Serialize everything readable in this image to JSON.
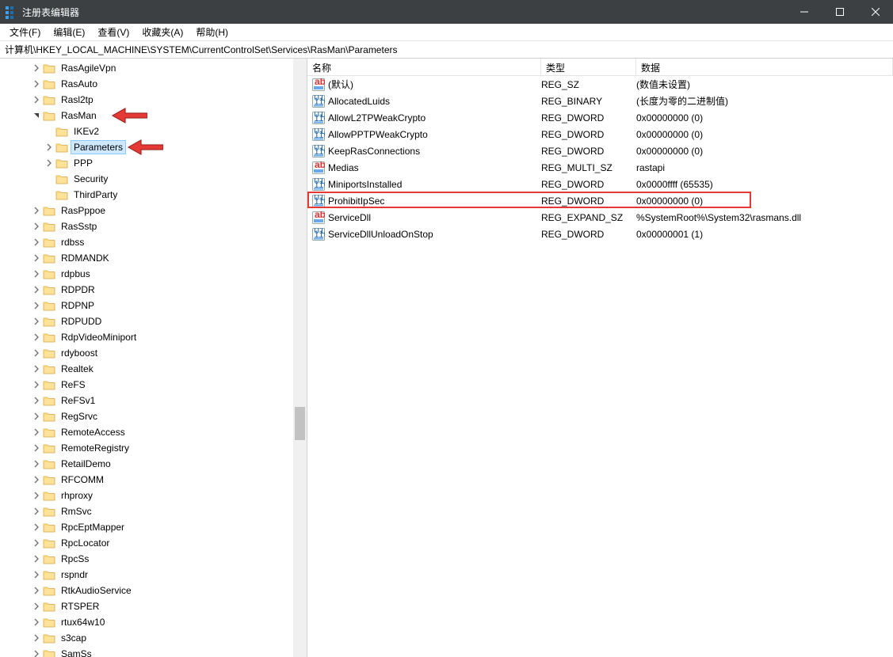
{
  "window": {
    "title": "注册表编辑器"
  },
  "menu": {
    "file": "文件(F)",
    "edit": "编辑(E)",
    "view": "查看(V)",
    "fav": "收藏夹(A)",
    "help": "帮助(H)"
  },
  "pathbar": "计算机\\HKEY_LOCAL_MACHINE\\SYSTEM\\CurrentControlSet\\Services\\RasMan\\Parameters",
  "tree": [
    {
      "indent": 2,
      "exp": ">",
      "label": "RasAgileVpn"
    },
    {
      "indent": 2,
      "exp": ">",
      "label": "RasAuto"
    },
    {
      "indent": 2,
      "exp": ">",
      "label": "Rasl2tp"
    },
    {
      "indent": 2,
      "exp": "v",
      "label": "RasMan",
      "arrow": 1
    },
    {
      "indent": 3,
      "exp": "",
      "label": "IKEv2"
    },
    {
      "indent": 3,
      "exp": ">",
      "label": "Parameters",
      "selected": true,
      "arrow": 2
    },
    {
      "indent": 3,
      "exp": ">",
      "label": "PPP"
    },
    {
      "indent": 3,
      "exp": "",
      "label": "Security"
    },
    {
      "indent": 3,
      "exp": "",
      "label": "ThirdParty"
    },
    {
      "indent": 2,
      "exp": ">",
      "label": "RasPppoe"
    },
    {
      "indent": 2,
      "exp": ">",
      "label": "RasSstp"
    },
    {
      "indent": 2,
      "exp": ">",
      "label": "rdbss"
    },
    {
      "indent": 2,
      "exp": ">",
      "label": "RDMANDK"
    },
    {
      "indent": 2,
      "exp": ">",
      "label": "rdpbus"
    },
    {
      "indent": 2,
      "exp": ">",
      "label": "RDPDR"
    },
    {
      "indent": 2,
      "exp": ">",
      "label": "RDPNP"
    },
    {
      "indent": 2,
      "exp": ">",
      "label": "RDPUDD"
    },
    {
      "indent": 2,
      "exp": ">",
      "label": "RdpVideoMiniport"
    },
    {
      "indent": 2,
      "exp": ">",
      "label": "rdyboost"
    },
    {
      "indent": 2,
      "exp": ">",
      "label": "Realtek"
    },
    {
      "indent": 2,
      "exp": ">",
      "label": "ReFS"
    },
    {
      "indent": 2,
      "exp": ">",
      "label": "ReFSv1"
    },
    {
      "indent": 2,
      "exp": ">",
      "label": "RegSrvc"
    },
    {
      "indent": 2,
      "exp": ">",
      "label": "RemoteAccess"
    },
    {
      "indent": 2,
      "exp": ">",
      "label": "RemoteRegistry"
    },
    {
      "indent": 2,
      "exp": ">",
      "label": "RetailDemo"
    },
    {
      "indent": 2,
      "exp": ">",
      "label": "RFCOMM"
    },
    {
      "indent": 2,
      "exp": ">",
      "label": "rhproxy"
    },
    {
      "indent": 2,
      "exp": ">",
      "label": "RmSvc"
    },
    {
      "indent": 2,
      "exp": ">",
      "label": "RpcEptMapper"
    },
    {
      "indent": 2,
      "exp": ">",
      "label": "RpcLocator"
    },
    {
      "indent": 2,
      "exp": ">",
      "label": "RpcSs"
    },
    {
      "indent": 2,
      "exp": ">",
      "label": "rspndr"
    },
    {
      "indent": 2,
      "exp": ">",
      "label": "RtkAudioService"
    },
    {
      "indent": 2,
      "exp": ">",
      "label": "RTSPER"
    },
    {
      "indent": 2,
      "exp": ">",
      "label": "rtux64w10"
    },
    {
      "indent": 2,
      "exp": ">",
      "label": "s3cap"
    },
    {
      "indent": 2,
      "exp": ">",
      "label": "SamSs"
    }
  ],
  "columns": {
    "name": "名称",
    "type": "类型",
    "data": "数据"
  },
  "colWidths": {
    "name": 295,
    "type": 120
  },
  "values": [
    {
      "icon": "sz",
      "name": "(默认)",
      "type": "REG_SZ",
      "data": "(数值未设置)"
    },
    {
      "icon": "bin",
      "name": "AllocatedLuids",
      "type": "REG_BINARY",
      "data": "(长度为零的二进制值)"
    },
    {
      "icon": "bin",
      "name": "AllowL2TPWeakCrypto",
      "type": "REG_DWORD",
      "data": "0x00000000 (0)"
    },
    {
      "icon": "bin",
      "name": "AllowPPTPWeakCrypto",
      "type": "REG_DWORD",
      "data": "0x00000000 (0)"
    },
    {
      "icon": "bin",
      "name": "KeepRasConnections",
      "type": "REG_DWORD",
      "data": "0x00000000 (0)"
    },
    {
      "icon": "sz",
      "name": "Medias",
      "type": "REG_MULTI_SZ",
      "data": "rastapi"
    },
    {
      "icon": "bin",
      "name": "MiniportsInstalled",
      "type": "REG_DWORD",
      "data": "0x0000ffff (65535)"
    },
    {
      "icon": "bin",
      "name": "ProhibitIpSec",
      "type": "REG_DWORD",
      "data": "0x00000000 (0)",
      "highlight": true
    },
    {
      "icon": "sz",
      "name": "ServiceDll",
      "type": "REG_EXPAND_SZ",
      "data": "%SystemRoot%\\System32\\rasmans.dll"
    },
    {
      "icon": "bin",
      "name": "ServiceDllUnloadOnStop",
      "type": "REG_DWORD",
      "data": "0x00000001 (1)"
    }
  ],
  "icons": {
    "sz_label": "ab",
    "bin_label": "011\n110"
  }
}
